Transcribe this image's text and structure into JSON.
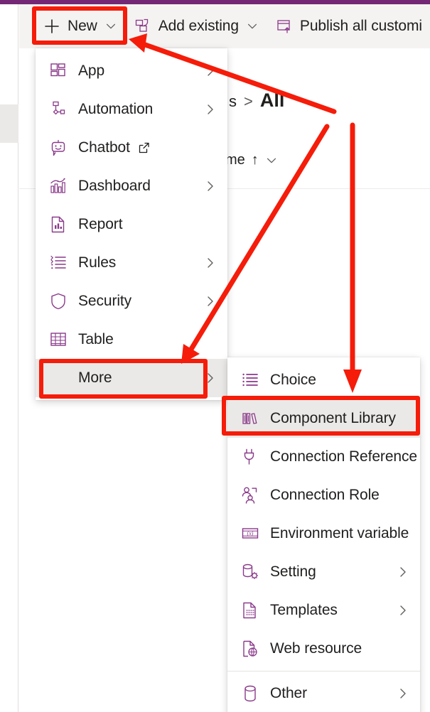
{
  "theme": {
    "accent_purple": "#742774",
    "icon_purple": "#8a3a8a",
    "annotation_red": "#f51c0a",
    "command_bar_bg": "#f5f3f2",
    "hover_bg": "#ebe9e7",
    "text": "#201f1e"
  },
  "command_bar": {
    "buttons": [
      {
        "label": "New",
        "icon": "plus-icon",
        "has_chevron": true
      },
      {
        "label": "Add existing",
        "icon": "add-existing-icon",
        "has_chevron": true
      },
      {
        "label": "Publish all customi",
        "icon": "publish-icon",
        "has_chevron": false,
        "truncated": true
      }
    ]
  },
  "page": {
    "breadcrumb": {
      "previous_partial": "s",
      "separator": ">",
      "current": "All"
    },
    "column_header": {
      "label_partial": "me",
      "sort_indicator": "↑",
      "chevron": "chevron-down-icon"
    }
  },
  "menu_new": {
    "items": [
      {
        "label": "App",
        "icon": "app-grid-icon",
        "submenu": true,
        "external": false,
        "hovered": false
      },
      {
        "label": "Automation",
        "icon": "automation-icon",
        "submenu": true,
        "external": false,
        "hovered": false
      },
      {
        "label": "Chatbot",
        "icon": "chatbot-icon",
        "submenu": false,
        "external": true,
        "hovered": false
      },
      {
        "label": "Dashboard",
        "icon": "dashboard-chart-icon",
        "submenu": true,
        "external": false,
        "hovered": false
      },
      {
        "label": "Report",
        "icon": "report-icon",
        "submenu": false,
        "external": false,
        "hovered": false
      },
      {
        "label": "Rules",
        "icon": "rules-list-icon",
        "submenu": true,
        "external": false,
        "hovered": false
      },
      {
        "label": "Security",
        "icon": "shield-icon",
        "submenu": true,
        "external": false,
        "hovered": false
      },
      {
        "label": "Table",
        "icon": "table-grid-icon",
        "submenu": false,
        "external": false,
        "hovered": false
      },
      {
        "label": "More",
        "icon": "",
        "submenu": true,
        "external": false,
        "hovered": true
      }
    ]
  },
  "menu_more": {
    "items": [
      {
        "label": "Choice",
        "icon": "choice-list-icon",
        "submenu": false,
        "hovered": false,
        "divider_after": false
      },
      {
        "label": "Component Library",
        "icon": "component-library-icon",
        "submenu": false,
        "hovered": true,
        "divider_after": false
      },
      {
        "label": "Connection Reference",
        "icon": "plug-icon",
        "submenu": false,
        "hovered": false,
        "divider_after": false
      },
      {
        "label": "Connection Role",
        "icon": "people-icon",
        "submenu": false,
        "hovered": false,
        "divider_after": false
      },
      {
        "label": "Environment variable",
        "icon": "variable-box-icon",
        "submenu": false,
        "hovered": false,
        "divider_after": false
      },
      {
        "label": "Setting",
        "icon": "setting-db-icon",
        "submenu": true,
        "hovered": false,
        "divider_after": false
      },
      {
        "label": "Templates",
        "icon": "template-page-icon",
        "submenu": true,
        "hovered": false,
        "divider_after": false
      },
      {
        "label": "Web resource",
        "icon": "web-resource-icon",
        "submenu": false,
        "hovered": false,
        "divider_after": true
      },
      {
        "label": "Other",
        "icon": "database-icon",
        "submenu": true,
        "hovered": false,
        "divider_after": false
      }
    ]
  },
  "annotations": {
    "boxes": [
      {
        "target": "New"
      },
      {
        "target": "More"
      },
      {
        "target": "Component Library"
      }
    ],
    "arrows": [
      {
        "from": "content-area-right",
        "to": "New button"
      },
      {
        "from": "content-area-right",
        "to": "More menu item"
      },
      {
        "from": "content-area-top",
        "to": "Component Library menu item"
      }
    ]
  }
}
